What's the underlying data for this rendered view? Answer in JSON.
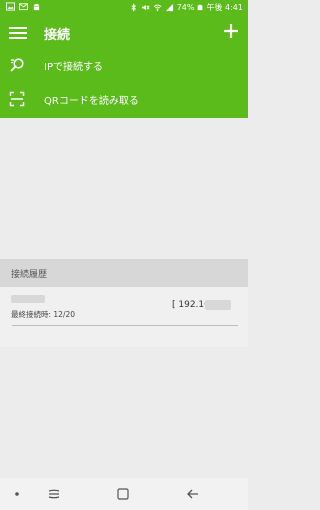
{
  "status_bar": {
    "battery": "74%",
    "time_label": "午後 4:41"
  },
  "app_bar": {
    "title": "接続"
  },
  "actions": [
    {
      "label": "IPで接続する",
      "icon": "ip-search-icon"
    },
    {
      "label": "QRコードを読み取る",
      "icon": "qr-scan-icon"
    }
  ],
  "history": {
    "header": "接続履歴",
    "items": [
      {
        "last_connected": "最終接続時: 12/20",
        "address": "[ 192.168."
      }
    ]
  },
  "colors": {
    "accent": "#5bbb1a",
    "background": "#ececec"
  }
}
